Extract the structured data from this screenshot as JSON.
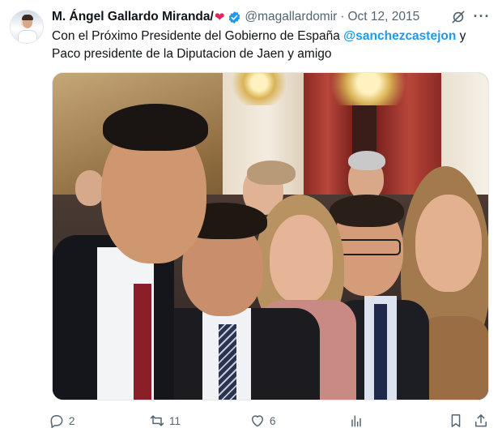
{
  "author": {
    "display_name": "M. Ángel Gallardo Miranda/",
    "emoji": "❤",
    "handle": "@magallardomir",
    "separator": "·",
    "date": "Oct 12, 2015",
    "avatar_icon": "profile-avatar",
    "verified_icon": "verified-badge-icon",
    "verified_color": "#1d9bf0"
  },
  "tweet": {
    "text_before": "Con el Próximo Presidente del Gobierno de España ",
    "mention": "@sanchezcastejon",
    "text_after": " y Paco presidente de la Diputacion de Jaen y amigo",
    "mention_color": "#1d9bf0"
  },
  "media": {
    "type": "photo",
    "description_icon": "group-selfie-photo"
  },
  "top_actions": {
    "grok_icon": "grok-icon",
    "more_icon": "more-options-icon",
    "more_label": "···"
  },
  "actions": {
    "replies": "2",
    "reposts": "11",
    "likes": "6",
    "views": "",
    "icons": [
      "reply-icon",
      "repost-icon",
      "like-icon",
      "views-icon",
      "bookmark-icon",
      "share-icon"
    ]
  }
}
